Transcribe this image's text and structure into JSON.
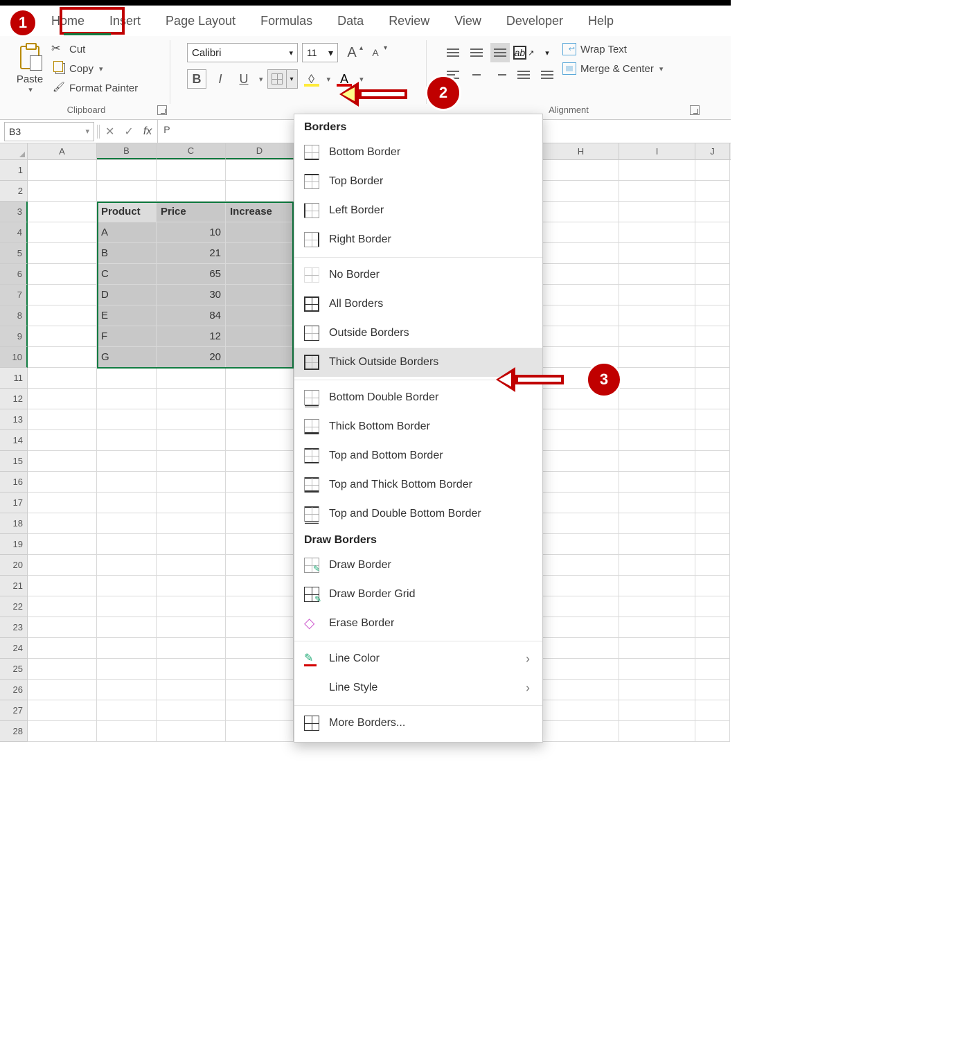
{
  "tabs": [
    "Home",
    "Insert",
    "Page Layout",
    "Formulas",
    "Data",
    "Review",
    "View",
    "Developer",
    "Help"
  ],
  "clipboard": {
    "paste": "Paste",
    "cut": "Cut",
    "copy": "Copy",
    "format_painter": "Format Painter",
    "group": "Clipboard"
  },
  "font": {
    "name": "Calibri",
    "size": "11"
  },
  "alignment": {
    "wrap": "Wrap Text",
    "merge": "Merge & Center",
    "group": "Alignment"
  },
  "namebox": "B3",
  "formula_preview": "P",
  "columns": [
    "A",
    "B",
    "C",
    "D",
    "H",
    "I",
    "J"
  ],
  "rows": 28,
  "table": {
    "headers": [
      "Product",
      "Price",
      "Increase"
    ],
    "rows": [
      {
        "product": "A",
        "price": "10"
      },
      {
        "product": "B",
        "price": "21"
      },
      {
        "product": "C",
        "price": "65"
      },
      {
        "product": "D",
        "price": "30"
      },
      {
        "product": "E",
        "price": "84"
      },
      {
        "product": "F",
        "price": "12"
      },
      {
        "product": "G",
        "price": "20"
      }
    ]
  },
  "menu": {
    "borders_header": "Borders",
    "draw_header": "Draw Borders",
    "items1": [
      "Bottom Border",
      "Top Border",
      "Left Border",
      "Right Border"
    ],
    "items2": [
      "No Border",
      "All Borders",
      "Outside Borders",
      "Thick Outside Borders"
    ],
    "items3": [
      "Bottom Double Border",
      "Thick Bottom Border",
      "Top and Bottom Border",
      "Top and Thick Bottom Border",
      "Top and Double Bottom Border"
    ],
    "draw_items": [
      "Draw Border",
      "Draw Border Grid",
      "Erase Border"
    ],
    "line_color": "Line Color",
    "line_style": "Line Style",
    "more": "More Borders..."
  },
  "callouts": {
    "c1": "1",
    "c2": "2",
    "c3": "3"
  }
}
